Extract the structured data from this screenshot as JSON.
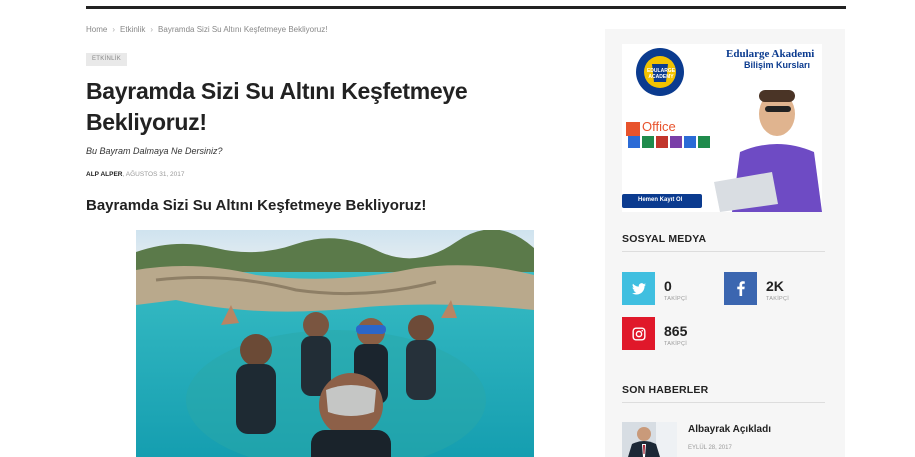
{
  "breadcrumb": {
    "home": "Home",
    "category": "Etkinlik",
    "current": "Bayramda Sizi Su Altını Keşfetmeye Bekliyoruz!"
  },
  "article": {
    "category_badge": "ETKİNLİK",
    "title": "Bayramda Sizi Su Altını Keşfetmeye Bekliyoruz!",
    "subtitle": "Bu Bayram Dalmaya Ne Dersiniz?",
    "author": "ALP ALPER",
    "date": ", AĞUSTOS 31, 2017",
    "heading": "Bayramda Sizi Su Altını Keşfetmeye Bekliyoruz!"
  },
  "sidebar": {
    "ad": {
      "logo_text": "EDULARGE ACADEMY",
      "title": "Edularge Akademi",
      "subtitle": "Bilişim Kursları",
      "office_label": "Office",
      "cta": "Hemen Kayıt Ol"
    },
    "social": {
      "title": "SOSYAL MEDYA",
      "items": [
        {
          "network": "twitter",
          "icon": "twitter-icon",
          "count": "0",
          "label": "TAKİPÇİ",
          "color": "#40bfe0"
        },
        {
          "network": "facebook",
          "icon": "facebook-icon",
          "count": "2K",
          "label": "TAKİPÇİ",
          "color": "#3b66b0"
        },
        {
          "network": "instagram",
          "icon": "instagram-icon",
          "count": "865",
          "label": "TAKİPÇİ",
          "color": "#e0182a"
        }
      ]
    },
    "news": {
      "title": "SON HABERLER",
      "items": [
        {
          "title": "Albayrak Açıkladı",
          "date": "EYLÜL 28, 2017"
        }
      ]
    }
  }
}
